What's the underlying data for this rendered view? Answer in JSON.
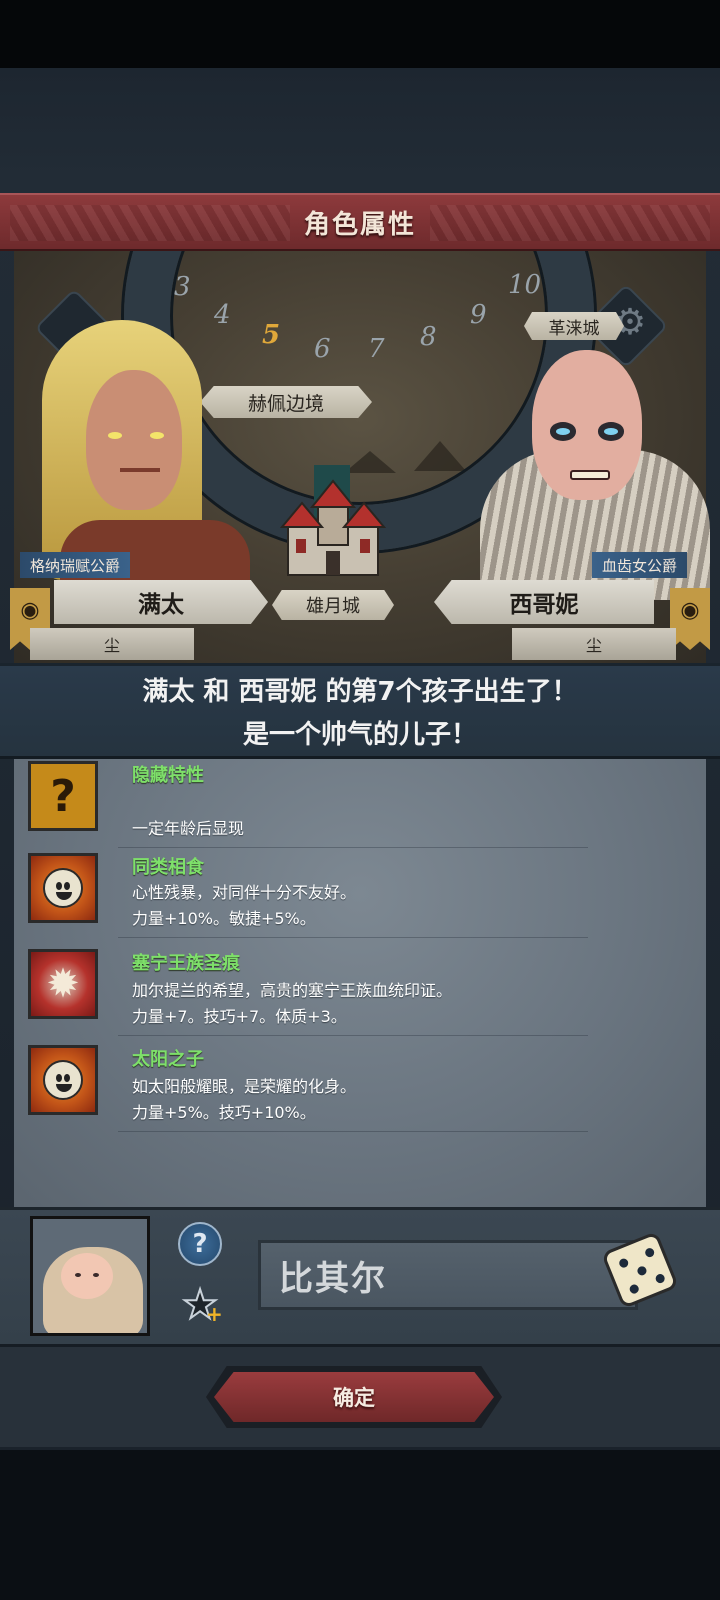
{
  "header": {
    "title": "角色属性"
  },
  "map": {
    "dial_numbers": [
      "3",
      "4",
      "5",
      "6",
      "7",
      "8",
      "9",
      "10"
    ],
    "current_number": "5",
    "locations": {
      "border": "赫佩边境",
      "city_right": "革涞城",
      "castle": "雄月城"
    }
  },
  "father": {
    "title": "格纳瑞赋公爵",
    "name": "满太",
    "sub": "尘"
  },
  "mother": {
    "title": "血齿女公爵",
    "name": "西哥妮",
    "sub": "尘"
  },
  "announcement": {
    "line1": "满太 和 西哥妮 的第7个孩子出生了！",
    "line2": "是一个帅气的儿子！"
  },
  "traits": [
    {
      "name": "隐藏特性",
      "desc1": "",
      "desc2": "一定年龄后显现",
      "icon": "question-icon"
    },
    {
      "name": "同类相食",
      "desc1": "心性残暴，对同伴十分不友好。",
      "desc2": "力量+10%。敏捷+5%。",
      "icon": "smiley-sun-icon"
    },
    {
      "name": "塞宁王族圣痕",
      "desc1": "加尔提兰的希望，高贵的塞宁王族血统印证。",
      "desc2": "力量+7。技巧+7。体质+3。",
      "icon": "royal-sigil-icon"
    },
    {
      "name": "太阳之子",
      "desc1": "如太阳般耀眼，是荣耀的化身。",
      "desc2": "力量+5%。技巧+10%。",
      "icon": "smiley-sun-icon"
    }
  ],
  "child": {
    "name": "比其尔"
  },
  "confirm_label": "确定",
  "colors": {
    "banner": "#8d3a3c",
    "trait_name": "#7ee06a",
    "panel": "#6a7580"
  }
}
